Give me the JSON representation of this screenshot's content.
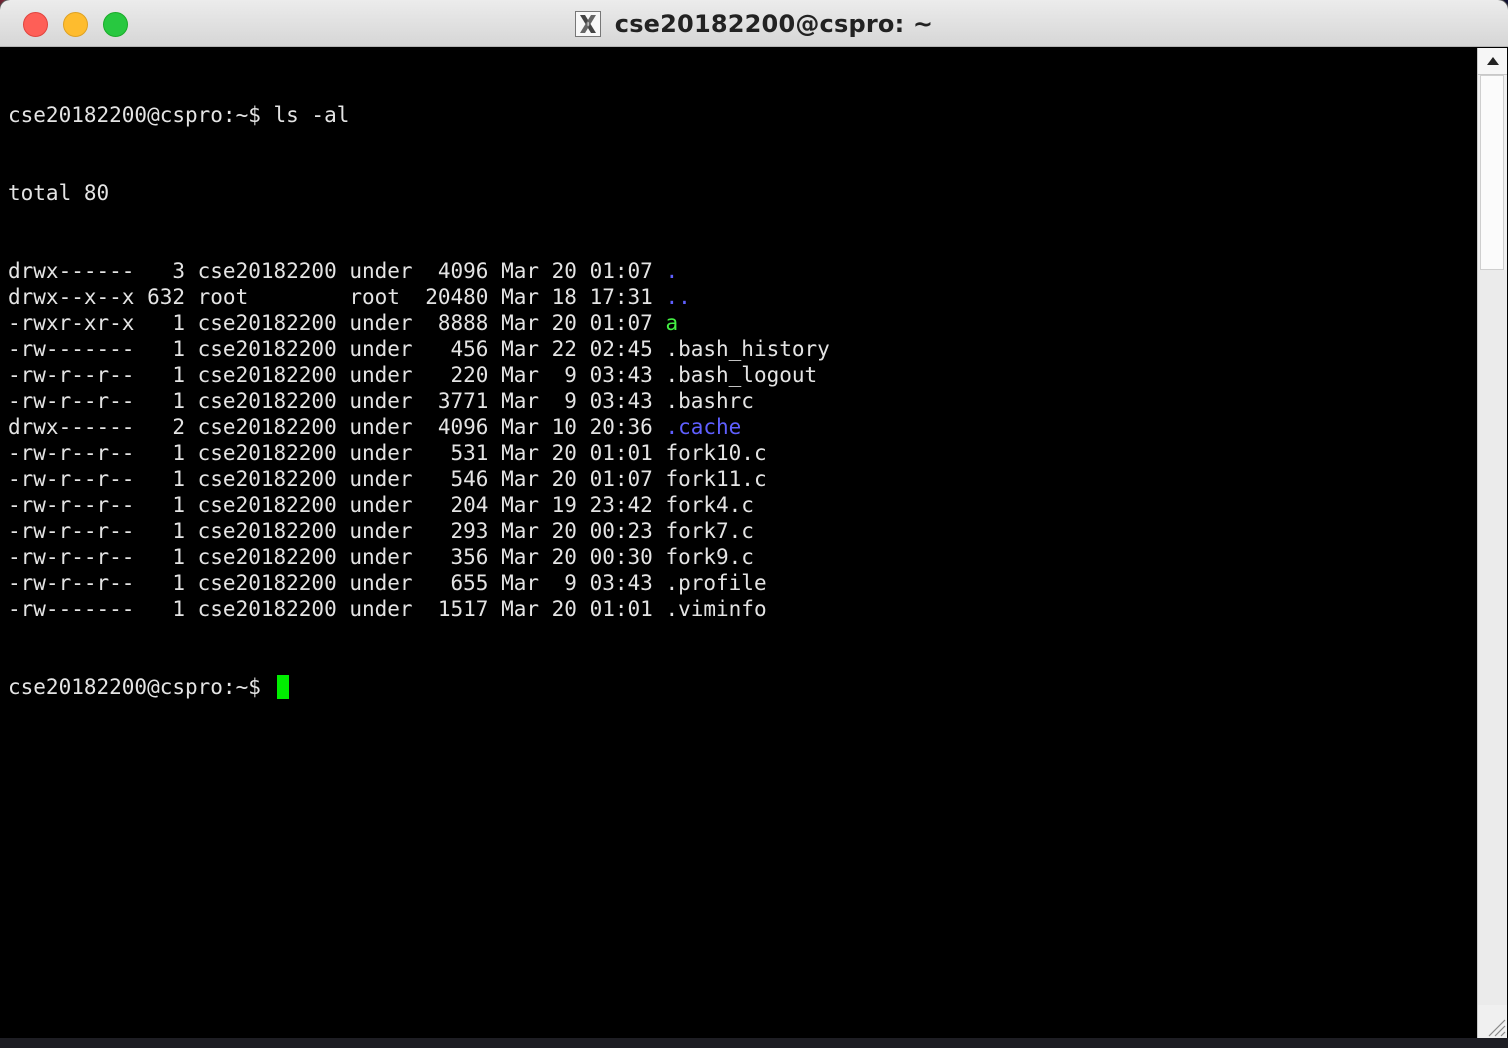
{
  "window": {
    "title": "cse20182200@cspro: ~",
    "app_icon": "x11-icon"
  },
  "colors": {
    "directory": "#5f5fff",
    "executable": "#44ee44",
    "text": "#e4e4e4",
    "cursor": "#00ee00",
    "background": "#000000"
  },
  "terminal": {
    "command_line": "cse20182200@cspro:~$ ls -al",
    "total_line": "total 80",
    "listing": [
      {
        "meta": "drwx------   3 cse20182200 under  4096 Mar 20 01:07 ",
        "name": ".",
        "type": "directory"
      },
      {
        "meta": "drwx--x--x 632 root        root  20480 Mar 18 17:31 ",
        "name": "..",
        "type": "directory"
      },
      {
        "meta": "-rwxr-xr-x   1 cse20182200 under  8888 Mar 20 01:07 ",
        "name": "a",
        "type": "executable"
      },
      {
        "meta": "-rw-------   1 cse20182200 under   456 Mar 22 02:45 ",
        "name": ".bash_history",
        "type": "file"
      },
      {
        "meta": "-rw-r--r--   1 cse20182200 under   220 Mar  9 03:43 ",
        "name": ".bash_logout",
        "type": "file"
      },
      {
        "meta": "-rw-r--r--   1 cse20182200 under  3771 Mar  9 03:43 ",
        "name": ".bashrc",
        "type": "file"
      },
      {
        "meta": "drwx------   2 cse20182200 under  4096 Mar 10 20:36 ",
        "name": ".cache",
        "type": "directory"
      },
      {
        "meta": "-rw-r--r--   1 cse20182200 under   531 Mar 20 01:01 ",
        "name": "fork10.c",
        "type": "file"
      },
      {
        "meta": "-rw-r--r--   1 cse20182200 under   546 Mar 20 01:07 ",
        "name": "fork11.c",
        "type": "file"
      },
      {
        "meta": "-rw-r--r--   1 cse20182200 under   204 Mar 19 23:42 ",
        "name": "fork4.c",
        "type": "file"
      },
      {
        "meta": "-rw-r--r--   1 cse20182200 under   293 Mar 20 00:23 ",
        "name": "fork7.c",
        "type": "file"
      },
      {
        "meta": "-rw-r--r--   1 cse20182200 under   356 Mar 20 00:30 ",
        "name": "fork9.c",
        "type": "file"
      },
      {
        "meta": "-rw-r--r--   1 cse20182200 under   655 Mar  9 03:43 ",
        "name": ".profile",
        "type": "file"
      },
      {
        "meta": "-rw-------   1 cse20182200 under  1517 Mar 20 01:01 ",
        "name": ".viminfo",
        "type": "file"
      }
    ],
    "prompt": "cse20182200@cspro:~$ "
  },
  "scrollbar": {
    "position_fraction": 0.0,
    "visible_fraction": 0.2
  }
}
